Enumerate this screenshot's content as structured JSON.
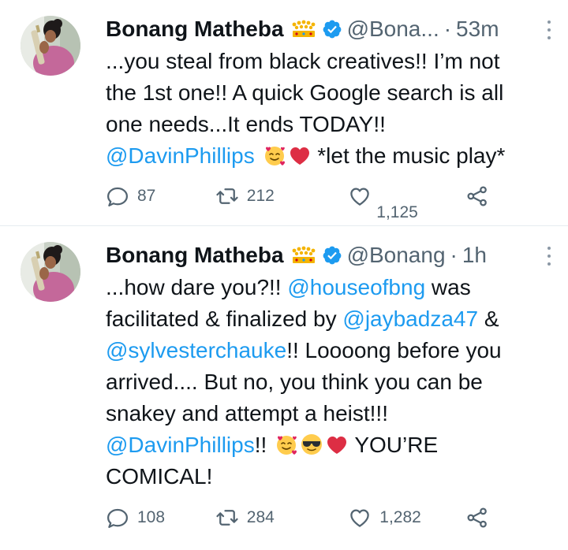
{
  "tweets": [
    {
      "author": {
        "name": "Bonang Matheba",
        "handle": "@Bona...",
        "crown_icon": "crown-emoji",
        "verified_icon": "verified-badge-icon"
      },
      "separator": "·",
      "time": "53m",
      "segments": {
        "l1": "...you steal from black creatives!! I’m not",
        "l2": "the 1st one!! A quick Google search is all",
        "l3": "one needs...It ends TODAY!!",
        "m1": "@DavinPhillips",
        "l4": " *let the music play*"
      },
      "reply_count": "87",
      "retweet_count": "212",
      "like_count": "1,125"
    },
    {
      "author": {
        "name": "Bonang Matheba",
        "handle": "@Bonang",
        "crown_icon": "crown-emoji",
        "verified_icon": "verified-badge-icon"
      },
      "separator": "·",
      "time": "1h",
      "segments": {
        "t1": "...how dare you?!! ",
        "m1": "@houseofbng",
        "t2": " was",
        "t3": "facilitated & finalized by ",
        "m2": "@jaybadza47",
        "t4": " &",
        "m3": "@sylvesterchauke",
        "t5": "!! Loooong before you",
        "t6": "arrived.... But no, you think you can be",
        "t7": "snakey and attempt a heist!!!",
        "m4": "@DavinPhillips",
        "t8": "!! ",
        "t9": "  YOU’RE",
        "t10": "COMICAL!"
      },
      "reply_count": "108",
      "retweet_count": "284",
      "like_count": "1,282"
    }
  ],
  "colors": {
    "text": "#0f1419",
    "muted": "#536471",
    "link": "#1d9bf0",
    "divider": "#e6ecf0",
    "verified": "#1d9bf0",
    "heart": "#e0245e"
  }
}
